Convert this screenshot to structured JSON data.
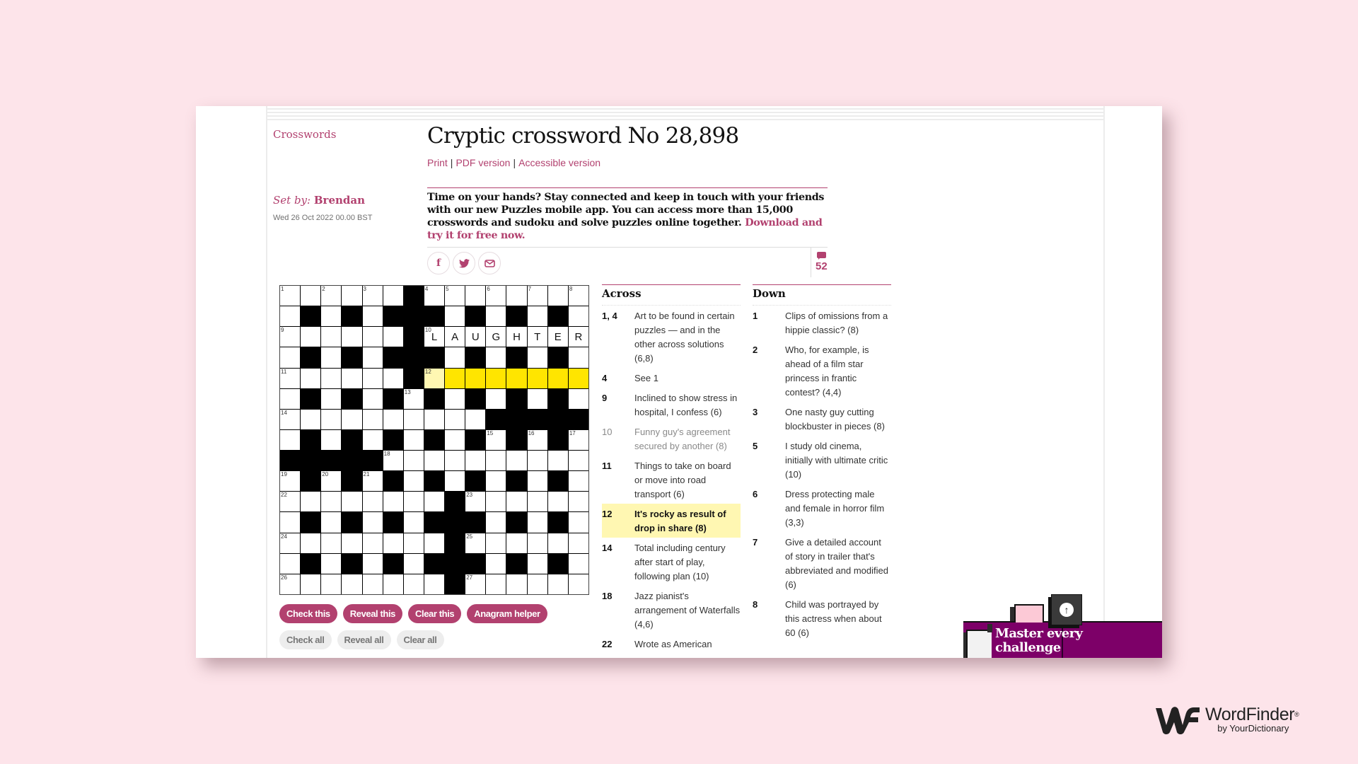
{
  "page": {
    "section_link": "Crosswords",
    "title": "Cryptic crossword No 28,898",
    "links": [
      "Print",
      "PDF version",
      "Accessible version"
    ],
    "set_by_label": "Set by:",
    "setter": "Brendan",
    "date": "Wed 26 Oct 2022 00.00 BST",
    "promo_text": "Time on your hands? Stay connected and keep in touch with your friends with our new Puzzles mobile app. You can access more than 15,000 crosswords and sudoku and solve puzzles online together.",
    "promo_link": "Download and try it for free now.",
    "share": [
      {
        "name": "facebook-icon",
        "glyph": "f"
      },
      {
        "name": "twitter-icon",
        "glyph": "🐦"
      },
      {
        "name": "email-icon",
        "glyph": "✉"
      }
    ],
    "comment_count": "52",
    "accent_color": "#b2416f"
  },
  "grid": {
    "size": 15,
    "layout": [
      "......#........",
      ".#.#.###.#.#.#.",
      "......#........",
      ".#.#.###.#.#.#.",
      "......#........",
      ".#.#.#.#.#.#.#.",
      "..........#####",
      ".#.#.#.#.#.#.#.",
      "#####..........",
      ".#.#.#.#.#.#.#.",
      "........#......",
      ".#.#.#.###.#.#.",
      "........#......",
      ".#.#.#.###.#.#.",
      "........#......"
    ],
    "numbers": [
      {
        "r": 0,
        "c": 0,
        "n": "1"
      },
      {
        "r": 0,
        "c": 2,
        "n": "2"
      },
      {
        "r": 0,
        "c": 4,
        "n": "3"
      },
      {
        "r": 0,
        "c": 7,
        "n": "4"
      },
      {
        "r": 0,
        "c": 8,
        "n": "5"
      },
      {
        "r": 0,
        "c": 10,
        "n": "6"
      },
      {
        "r": 0,
        "c": 12,
        "n": "7"
      },
      {
        "r": 0,
        "c": 14,
        "n": "8"
      },
      {
        "r": 2,
        "c": 0,
        "n": "9"
      },
      {
        "r": 2,
        "c": 7,
        "n": "10"
      },
      {
        "r": 4,
        "c": 0,
        "n": "11"
      },
      {
        "r": 4,
        "c": 7,
        "n": "12"
      },
      {
        "r": 5,
        "c": 6,
        "n": "13"
      },
      {
        "r": 6,
        "c": 0,
        "n": "14"
      },
      {
        "r": 7,
        "c": 10,
        "n": "15"
      },
      {
        "r": 7,
        "c": 12,
        "n": "16"
      },
      {
        "r": 7,
        "c": 14,
        "n": "17"
      },
      {
        "r": 8,
        "c": 5,
        "n": "18"
      },
      {
        "r": 9,
        "c": 0,
        "n": "19"
      },
      {
        "r": 9,
        "c": 2,
        "n": "20"
      },
      {
        "r": 9,
        "c": 4,
        "n": "21"
      },
      {
        "r": 10,
        "c": 0,
        "n": "22"
      },
      {
        "r": 10,
        "c": 9,
        "n": "23"
      },
      {
        "r": 12,
        "c": 0,
        "n": "24"
      },
      {
        "r": 12,
        "c": 9,
        "n": "25"
      },
      {
        "r": 14,
        "c": 0,
        "n": "26"
      },
      {
        "r": 14,
        "c": 9,
        "n": "27"
      }
    ],
    "entries": [
      {
        "r": 2,
        "c": 7,
        "v": "L"
      },
      {
        "r": 2,
        "c": 8,
        "v": "A"
      },
      {
        "r": 2,
        "c": 9,
        "v": "U"
      },
      {
        "r": 2,
        "c": 10,
        "v": "G"
      },
      {
        "r": 2,
        "c": 11,
        "v": "H"
      },
      {
        "r": 2,
        "c": 12,
        "v": "T"
      },
      {
        "r": 2,
        "c": 13,
        "v": "E"
      },
      {
        "r": 2,
        "c": 14,
        "v": "R"
      }
    ],
    "focus_cell": {
      "r": 4,
      "c": 7
    },
    "highlight_row": 4,
    "highlight_cols": [
      8,
      14
    ],
    "highlight_color": "#ffe500",
    "focus_color": "#fff7b2"
  },
  "controls": {
    "primary": [
      "Check this",
      "Reveal this",
      "Clear this",
      "Anagram helper"
    ],
    "secondary": [
      "Check all",
      "Reveal all",
      "Clear all"
    ]
  },
  "across": {
    "heading": "Across",
    "clues": [
      {
        "num": "1, 4",
        "text": "Art to be found in certain puzzles — and in the other across solutions (6,8)",
        "state": ""
      },
      {
        "num": "4",
        "text": "See 1",
        "state": ""
      },
      {
        "num": "9",
        "text": "Inclined to show stress in hospital, I confess (6)",
        "state": ""
      },
      {
        "num": "10",
        "text": "Funny guy's agreement secured by another (8)",
        "state": "done"
      },
      {
        "num": "11",
        "text": "Things to take on board or move into road transport (6)",
        "state": ""
      },
      {
        "num": "12",
        "text": "It's rocky as result of drop in share (8)",
        "state": "active"
      },
      {
        "num": "14",
        "text": "Total including century after start of play, following plan (10)",
        "state": ""
      },
      {
        "num": "18",
        "text": "Jazz pianist's arrangement of Waterfalls (4,6)",
        "state": ""
      },
      {
        "num": "22",
        "text": "Wrote as American",
        "state": ""
      }
    ]
  },
  "down": {
    "heading": "Down",
    "clues": [
      {
        "num": "1",
        "text": "Clips of omissions from a hippie classic? (8)",
        "state": ""
      },
      {
        "num": "2",
        "text": "Who, for example, is ahead of a film star princess in frantic contest? (4,4)",
        "state": ""
      },
      {
        "num": "3",
        "text": "One nasty guy cutting blockbuster in pieces (8)",
        "state": ""
      },
      {
        "num": "5",
        "text": "I study old cinema, initially with ultimate critic (10)",
        "state": ""
      },
      {
        "num": "6",
        "text": "Dress protecting male and female in horror film (3,3)",
        "state": ""
      },
      {
        "num": "7",
        "text": "Give a detailed account of story in trailer that's abbreviated and modified (6)",
        "state": ""
      },
      {
        "num": "8",
        "text": "Child was portrayed by this actress when about 60 (6)",
        "state": ""
      }
    ]
  },
  "ad": {
    "text_line1": "Master every",
    "text_line2": "challenge",
    "color": "#7d0068"
  },
  "scroll_top": {
    "glyph": "↑"
  },
  "watermark": {
    "name": "WordFinder",
    "registered": "®",
    "byline": "by YourDictionary"
  }
}
